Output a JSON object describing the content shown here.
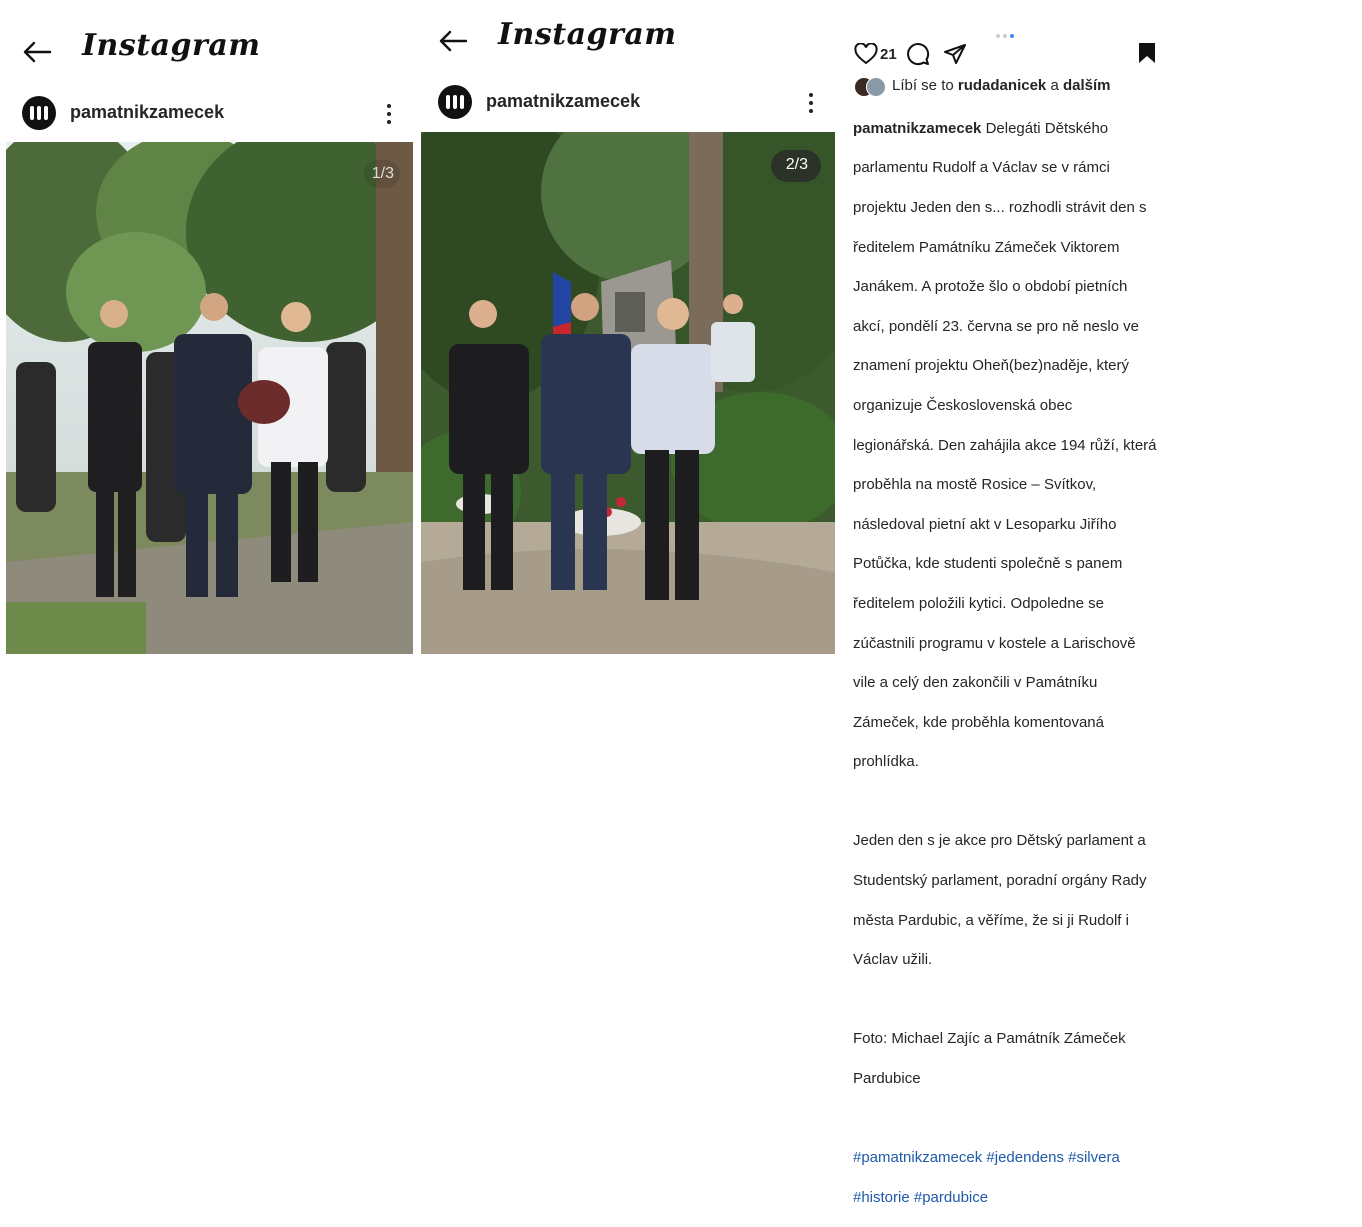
{
  "left": {
    "brand": "Instagram",
    "username": "pamatnikzamecek",
    "counter": "1/3"
  },
  "middle": {
    "brand": "Instagram",
    "username": "pamatnikzamecek",
    "counter": "2/3"
  },
  "right": {
    "like_count": "21",
    "liked_by_prefix": "Líbí se to",
    "liked_by_user": "rudadanicek",
    "liked_by_and": "a",
    "liked_by_others": "dalším",
    "caption_user": "pamatnikzamecek",
    "caption_lines": [
      " Delegáti Dětského",
      "parlamentu Rudolf a Václav se v rámci",
      "projektu Jeden den s... rozhodli strávit den s",
      "ředitelem Památníku Zámeček Viktorem",
      "Janákem. A protože šlo o období pietních",
      "akcí, pondělí 23. června se pro ně neslo ve",
      "znamení projektu Oheň(bez)naděje, který",
      "organizuje Československá obec",
      "legionářská. Den zahájila akce 194 růží, která",
      "proběhla na mostě Rosice – Svítkov,",
      "následoval pietní akt v Lesoparku Jiřího",
      "Potůčka, kde studenti společně s panem",
      "ředitelem položili kytici. Odpoledne se",
      "zúčastnili programu v kostele a Larischově",
      "vile a celý den zakončili v Památníku",
      "Zámeček, kde proběhla komentovaná",
      "prohlídka.",
      "",
      "Jeden den s je akce pro Dětský parlament a",
      "Studentský parlament, poradní orgány Rady",
      "města Pardubic, a věříme, že si ji Rudolf i",
      "Václav užili.",
      "",
      "Foto: Michael Zajíc a Památník Zámeček",
      "Pardubice",
      ""
    ],
    "hashtags_line1": "#pamatnikzamecek #jedendens #silvera",
    "hashtags_line2": "#historie #pardubice"
  },
  "colors": {
    "link": "#1e5aa8",
    "carousel_active_dot": "#3a8de8"
  },
  "icons": [
    "back-arrow-icon",
    "more-options-icon",
    "heart-icon",
    "comment-icon",
    "share-icon",
    "bookmark-icon"
  ]
}
